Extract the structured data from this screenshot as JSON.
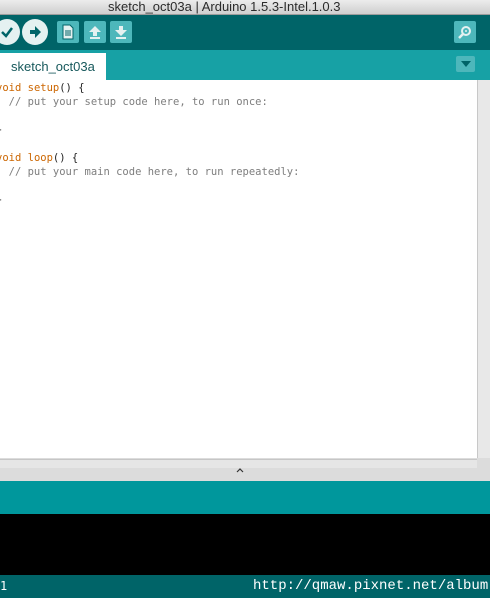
{
  "window": {
    "title": "sketch_oct03a | Arduino 1.5.3-Intel.1.0.3"
  },
  "toolbar": {
    "verify_icon": "checkmark-icon",
    "upload_icon": "arrow-right-icon",
    "new_icon": "new-file-icon",
    "open_icon": "arrow-up-icon",
    "save_icon": "arrow-down-icon",
    "serial_monitor_icon": "magnifier-icon"
  },
  "tabs": [
    {
      "label": "sketch_oct03a"
    }
  ],
  "editor": {
    "lines": [
      {
        "kw": "void",
        "fn": "setup",
        "rest": "() {"
      },
      {
        "text": "  // put your setup code here, to run once:"
      },
      {
        "text": ""
      },
      {
        "text": "}"
      },
      {
        "text": ""
      },
      {
        "kw": "void",
        "fn": "loop",
        "rest": "() {"
      },
      {
        "text": "  // put your main code here, to run repeatedly:"
      },
      {
        "text": ""
      },
      {
        "text": "}"
      }
    ]
  },
  "status": {
    "line_number": "1",
    "watermark": "http://qmaw.pixnet.net/album"
  },
  "colors": {
    "toolbar_bg": "#006468",
    "tab_row_bg": "#17a1a5",
    "console_header_bg": "#00979c",
    "keyword": "#cc6600",
    "comment": "#7e7e7e"
  }
}
